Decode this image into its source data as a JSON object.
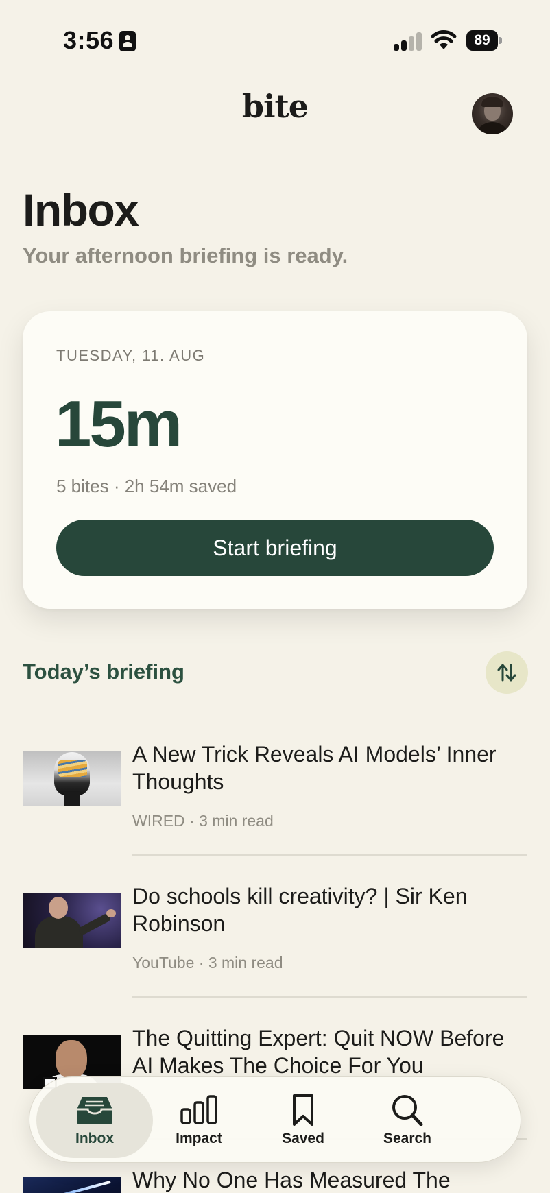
{
  "status_bar": {
    "time": "3:56",
    "battery": "89"
  },
  "header": {
    "logo": "bite"
  },
  "page": {
    "title": "Inbox",
    "subtitle": "Your afternoon briefing is ready."
  },
  "card": {
    "date": "TUESDAY, 11. AUG",
    "duration": "15m",
    "meta": "5 bites · 2h 54m saved",
    "button_label": "Start briefing"
  },
  "section": {
    "title": "Today’s briefing"
  },
  "articles": [
    {
      "title": "A New Trick Reveals AI Models’ Inner Thoughts",
      "meta": "WIRED · 3 min read"
    },
    {
      "title": "Do schools kill creativity? | Sir Ken Robinson",
      "meta": "YouTube · 3 min read"
    },
    {
      "title": "The Quitting Expert: Quit NOW Before AI Makes The Choice For You",
      "meta": ""
    },
    {
      "title": "Why No One Has Measured The",
      "meta": ""
    }
  ],
  "tabs": [
    {
      "label": "Inbox",
      "icon": "tray-icon",
      "active": true
    },
    {
      "label": "Impact",
      "icon": "bars-icon",
      "active": false
    },
    {
      "label": "Saved",
      "icon": "bookmark-icon",
      "active": false
    },
    {
      "label": "Search",
      "icon": "search-icon",
      "active": false
    }
  ],
  "colors": {
    "background": "#f5f2e8",
    "accent": "#27473a",
    "section_title": "#2c5140",
    "muted": "#8f8c82"
  }
}
